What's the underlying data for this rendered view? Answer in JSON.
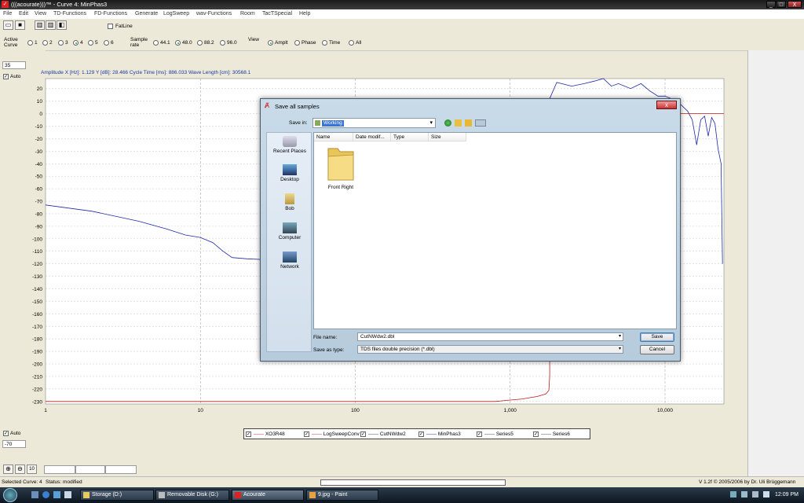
{
  "window": {
    "title": "(((acourate)))™ - Curve 4: MinPhas3",
    "min": "_",
    "max": "□",
    "close": "X"
  },
  "menu": [
    "File",
    "Edit",
    "View",
    "TD-Functions",
    "FD-Functions",
    "Generate",
    "LogSweep",
    "wav-Functions",
    "Room",
    "TacTSpecial",
    "Help"
  ],
  "toolbar": {
    "fatline_label": "FatLine"
  },
  "options": {
    "active_curve_label": "Active Curve",
    "curves": [
      "1",
      "2",
      "3",
      "4",
      "5",
      "6"
    ],
    "selected_curve": "4",
    "sample_rate_label": "Sample rate",
    "rates": [
      "44.1",
      "48.0",
      "88.2",
      "96.0"
    ],
    "selected_rate": "48.0",
    "view_label": "View",
    "views": [
      "Amplt",
      "Phase",
      "Time",
      "All"
    ],
    "selected_view": "Amplt"
  },
  "left": {
    "top_value": "35",
    "auto_label_top": "Auto",
    "auto_label_bottom": "Auto",
    "bottom_value": "-70"
  },
  "readout": "Amplitude   X [Hz]: 1.129   Y [dB]: 28.466   Cycle Time [ms]: 886.033   Wave Length [cm]: 30568.1",
  "chart_data": {
    "type": "line",
    "x_scale": "log",
    "xlim": [
      1,
      24000
    ],
    "ylim": [
      -232,
      28
    ],
    "x_ticks": [
      1,
      10,
      100,
      1000,
      10000
    ],
    "x_tick_labels": [
      "1",
      "10",
      "100",
      "1,000",
      "10,000"
    ],
    "y_ticks": [
      20,
      10,
      0,
      -10,
      -20,
      -30,
      -40,
      -50,
      -60,
      -70,
      -80,
      -90,
      -100,
      -110,
      -120,
      -130,
      -140,
      -150,
      -160,
      -170,
      -180,
      -190,
      -200,
      -210,
      -220,
      -230
    ],
    "grid": true,
    "series": [
      {
        "color": "#1c2aa8",
        "points": [
          [
            1,
            -73
          ],
          [
            2,
            -78
          ],
          [
            4,
            -86
          ],
          [
            6,
            -92
          ],
          [
            8,
            -97
          ],
          [
            10,
            -99
          ],
          [
            12,
            -103
          ],
          [
            14,
            -110
          ],
          [
            16,
            -115
          ],
          [
            20,
            -116
          ],
          [
            30,
            -117
          ],
          [
            50,
            -117
          ],
          [
            100,
            -117
          ],
          [
            200,
            -117
          ],
          [
            300,
            -117
          ],
          [
            1800,
            -117
          ],
          [
            1800,
            12
          ],
          [
            2000,
            25
          ],
          [
            2500,
            22
          ],
          [
            3000,
            24
          ],
          [
            3500,
            26
          ],
          [
            4000,
            28
          ],
          [
            4500,
            22
          ],
          [
            5000,
            24
          ],
          [
            6000,
            20
          ],
          [
            7000,
            24
          ],
          [
            8000,
            18
          ],
          [
            9000,
            14
          ],
          [
            10000,
            14
          ],
          [
            12000,
            10
          ],
          [
            14000,
            2
          ],
          [
            15000,
            -5
          ],
          [
            16000,
            -25
          ],
          [
            17000,
            -5
          ],
          [
            18000,
            -2
          ],
          [
            19000,
            -18
          ],
          [
            20000,
            -3
          ],
          [
            21000,
            -8
          ],
          [
            22000,
            -28
          ],
          [
            23000,
            -40
          ],
          [
            23500,
            -120
          ]
        ]
      },
      {
        "color": "#c01818",
        "points": [
          [
            1,
            -230
          ],
          [
            300,
            -230
          ],
          [
            800,
            -230
          ],
          [
            1200,
            -228
          ],
          [
            1500,
            -226
          ],
          [
            1700,
            -224
          ],
          [
            1780,
            -221
          ],
          [
            1800,
            -210
          ],
          [
            1800,
            0
          ],
          [
            24000,
            0
          ]
        ]
      }
    ]
  },
  "legend": [
    "XO3R48",
    "LogSweepConv",
    "CutNWdw2",
    "MinPhas3",
    "Series5",
    "Series6"
  ],
  "dialog": {
    "title": "Save all samples",
    "save_in_label": "Save in:",
    "save_in_value": "Working",
    "columns": [
      "Name",
      "Date modif...",
      "Type",
      "Size"
    ],
    "places": [
      "Recent Places",
      "Desktop",
      "Bob",
      "Computer",
      "Network"
    ],
    "folder_name": "Front Right",
    "file_name_label": "File name:",
    "file_name_value": "CutNWdw2.dbl",
    "save_type_label": "Save as type:",
    "save_type_value": "TDS files double precision (*.dbl)",
    "save_button": "Save",
    "cancel_button": "Cancel",
    "close": "x"
  },
  "zoom": {
    "label": "10"
  },
  "status": {
    "selected": "Selected Curve: 4",
    "status": "Status: modified",
    "version": "V 1.2f © 2005/2006 by Dr. Uli Brüggemann"
  },
  "taskbar": {
    "items": [
      "Storage (D:)",
      "Removable Disk (G:)",
      "Acourate",
      "9.jpg - Paint"
    ],
    "time": "12:09 PM"
  }
}
